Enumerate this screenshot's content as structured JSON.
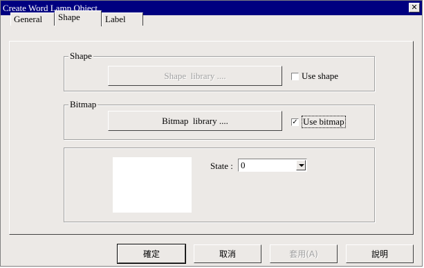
{
  "window": {
    "title": "Create Word Lamp Object",
    "close_glyph": "✕"
  },
  "tabs": [
    {
      "label": "General"
    },
    {
      "label": "Shape"
    },
    {
      "label": "Label"
    }
  ],
  "shape_group": {
    "label": "Shape",
    "library_button": "Shape  library ....",
    "use_checkbox": {
      "label": "Use shape",
      "checked": false
    }
  },
  "bitmap_group": {
    "label": "Bitmap",
    "library_button": "Bitmap  library ....",
    "use_checkbox": {
      "label": "Use bitmap",
      "checked": true,
      "mark": "✓"
    }
  },
  "state": {
    "label": "State :",
    "value": "0"
  },
  "footer": {
    "ok": "確定",
    "cancel": "取消",
    "apply": "套用(A)",
    "help": "說明"
  }
}
